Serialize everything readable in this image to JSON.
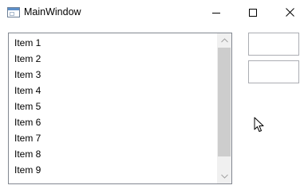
{
  "window": {
    "title": "MainWindow",
    "icon": "app-window-icon",
    "controls": {
      "minimize_icon": "minimize-icon",
      "maximize_icon": "maximize-icon",
      "close_icon": "close-icon"
    }
  },
  "listbox": {
    "items": [
      "Item 1",
      "Item 2",
      "Item 3",
      "Item 4",
      "Item 5",
      "Item 6",
      "Item 7",
      "Item 8",
      "Item 9"
    ],
    "scrollbar": {
      "up_icon": "scroll-up-arrow-icon",
      "down_icon": "scroll-down-arrow-icon"
    }
  },
  "textboxes": [
    {
      "value": ""
    },
    {
      "value": ""
    }
  ],
  "cursor": {
    "icon": "mouse-pointer-icon"
  },
  "colors": {
    "listbox_border": "#828790",
    "scrollbar_track": "#f0f0f0",
    "scrollbar_thumb": "#cdcdcd",
    "textbox_border": "#abadb3"
  }
}
